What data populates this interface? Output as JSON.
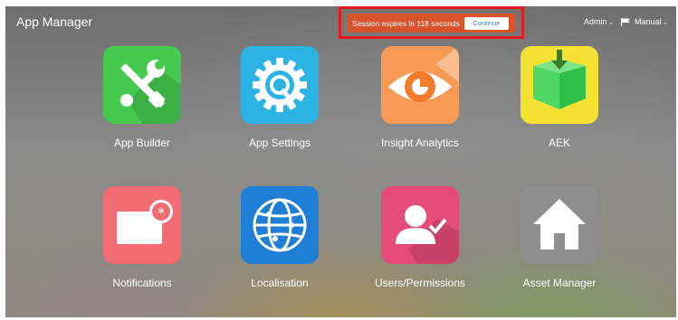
{
  "header": {
    "title": "App Manager",
    "session_text": "Session expires in 118 seconds",
    "continue_label": "Continue",
    "admin_label": "Admin",
    "manual_label": "Manual"
  },
  "apps": [
    {
      "label": "App Builder",
      "icon": "tools-icon",
      "color": "#46c94f"
    },
    {
      "label": "App Settings",
      "icon": "gear-magnifier-icon",
      "color": "#2bb3e3"
    },
    {
      "label": "Insight Analytics",
      "icon": "eye-icon",
      "color": "#f69a55"
    },
    {
      "label": "AEK",
      "icon": "box-icon",
      "color": "#f5e134"
    },
    {
      "label": "Notifications",
      "icon": "notification-icon",
      "color": "#f36b73"
    },
    {
      "label": "Localisation",
      "icon": "globe-icon",
      "color": "#1f7fd6"
    },
    {
      "label": "Users/Permissions",
      "icon": "user-check-icon",
      "color": "#e44b76"
    },
    {
      "label": "Asset Manager",
      "icon": "house-icon",
      "color": "#8f8f8f"
    }
  ],
  "colors": {
    "session_bg": "#d9532b",
    "highlight_border": "#e31b1b"
  }
}
